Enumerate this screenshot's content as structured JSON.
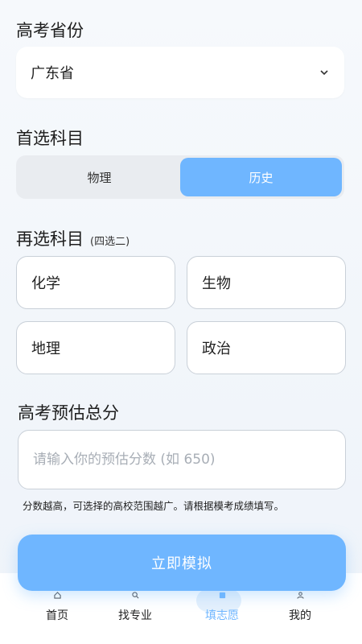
{
  "province": {
    "title": "高考省份",
    "selected": "广东省"
  },
  "first_subject": {
    "title": "首选科目",
    "options": [
      "物理",
      "历史"
    ],
    "selected": "历史"
  },
  "second_subject": {
    "title": "再选科目",
    "hint": "(四选二)",
    "options": [
      "化学",
      "生物",
      "地理",
      "政治"
    ]
  },
  "score": {
    "title": "高考预估总分",
    "placeholder": "请输入你的预估分数 (如 650)",
    "helper": "分数越高，可选择的高校范围越广。请根据模考成绩填写。"
  },
  "actions": {
    "submit_label": "立即模拟"
  },
  "tabbar": {
    "items": [
      {
        "label": "首页",
        "icon": "home-icon"
      },
      {
        "label": "找专业",
        "icon": "search-icon"
      },
      {
        "label": "填志愿",
        "icon": "form-icon"
      },
      {
        "label": "我的",
        "icon": "user-icon"
      }
    ],
    "active": "填志愿"
  },
  "colors": {
    "accent": "#6fb6ff",
    "border": "#c9d0d8",
    "background": "#f3f7fb"
  }
}
